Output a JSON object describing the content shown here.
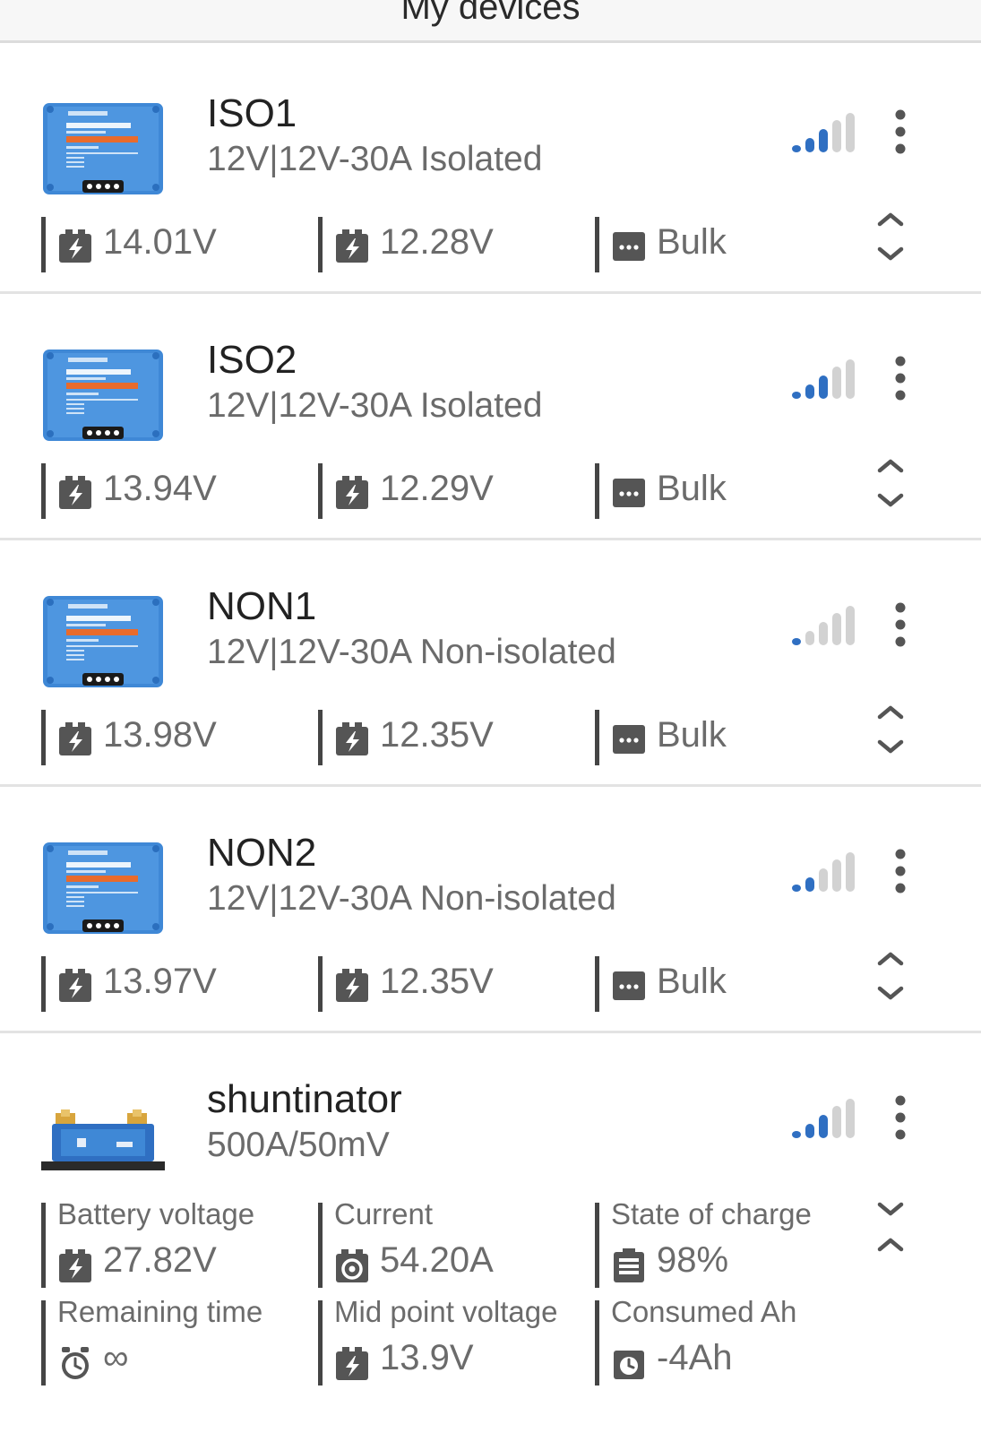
{
  "header": {
    "title": "My devices"
  },
  "devices": [
    {
      "name": "ISO1",
      "model": "12V|12V-30A Isolated",
      "metrics": [
        {
          "icon": "battery-icon",
          "value": "14.01V"
        },
        {
          "icon": "battery-icon",
          "value": "12.28V"
        },
        {
          "icon": "state-icon",
          "value": "Bulk"
        }
      ],
      "signal_bars": 3
    },
    {
      "name": "ISO2",
      "model": "12V|12V-30A Isolated",
      "metrics": [
        {
          "icon": "battery-icon",
          "value": "13.94V"
        },
        {
          "icon": "battery-icon",
          "value": "12.29V"
        },
        {
          "icon": "state-icon",
          "value": "Bulk"
        }
      ],
      "signal_bars": 3
    },
    {
      "name": "NON1",
      "model": "12V|12V-30A Non-isolated",
      "metrics": [
        {
          "icon": "battery-icon",
          "value": "13.98V"
        },
        {
          "icon": "battery-icon",
          "value": "12.35V"
        },
        {
          "icon": "state-icon",
          "value": "Bulk"
        }
      ],
      "signal_bars": 1
    },
    {
      "name": "NON2",
      "model": "12V|12V-30A Non-isolated",
      "metrics": [
        {
          "icon": "battery-icon",
          "value": "13.97V"
        },
        {
          "icon": "battery-icon",
          "value": "12.35V"
        },
        {
          "icon": "state-icon",
          "value": "Bulk"
        }
      ],
      "signal_bars": 2
    },
    {
      "name": "shuntinator",
      "model": "500A/50mV",
      "metrics": [
        {
          "label": "Battery voltage",
          "icon": "battery-icon",
          "value": "27.82V"
        },
        {
          "label": "Current",
          "icon": "current-icon",
          "value": "54.20A"
        },
        {
          "label": "State of charge",
          "icon": "soc-icon",
          "value": "98%"
        },
        {
          "label": "Remaining time",
          "icon": "clock-icon",
          "value": "∞"
        },
        {
          "label": "Mid point voltage",
          "icon": "battery-icon",
          "value": "13.9V"
        },
        {
          "label": "Consumed Ah",
          "icon": "consumed-icon",
          "value": "-4Ah"
        }
      ],
      "signal_bars": 3
    }
  ],
  "colors": {
    "signal_active": "#2f6fc2",
    "signal_inactive": "#d2d2d2",
    "device_blue": "#3f88d6",
    "icon_gray": "#555555"
  }
}
